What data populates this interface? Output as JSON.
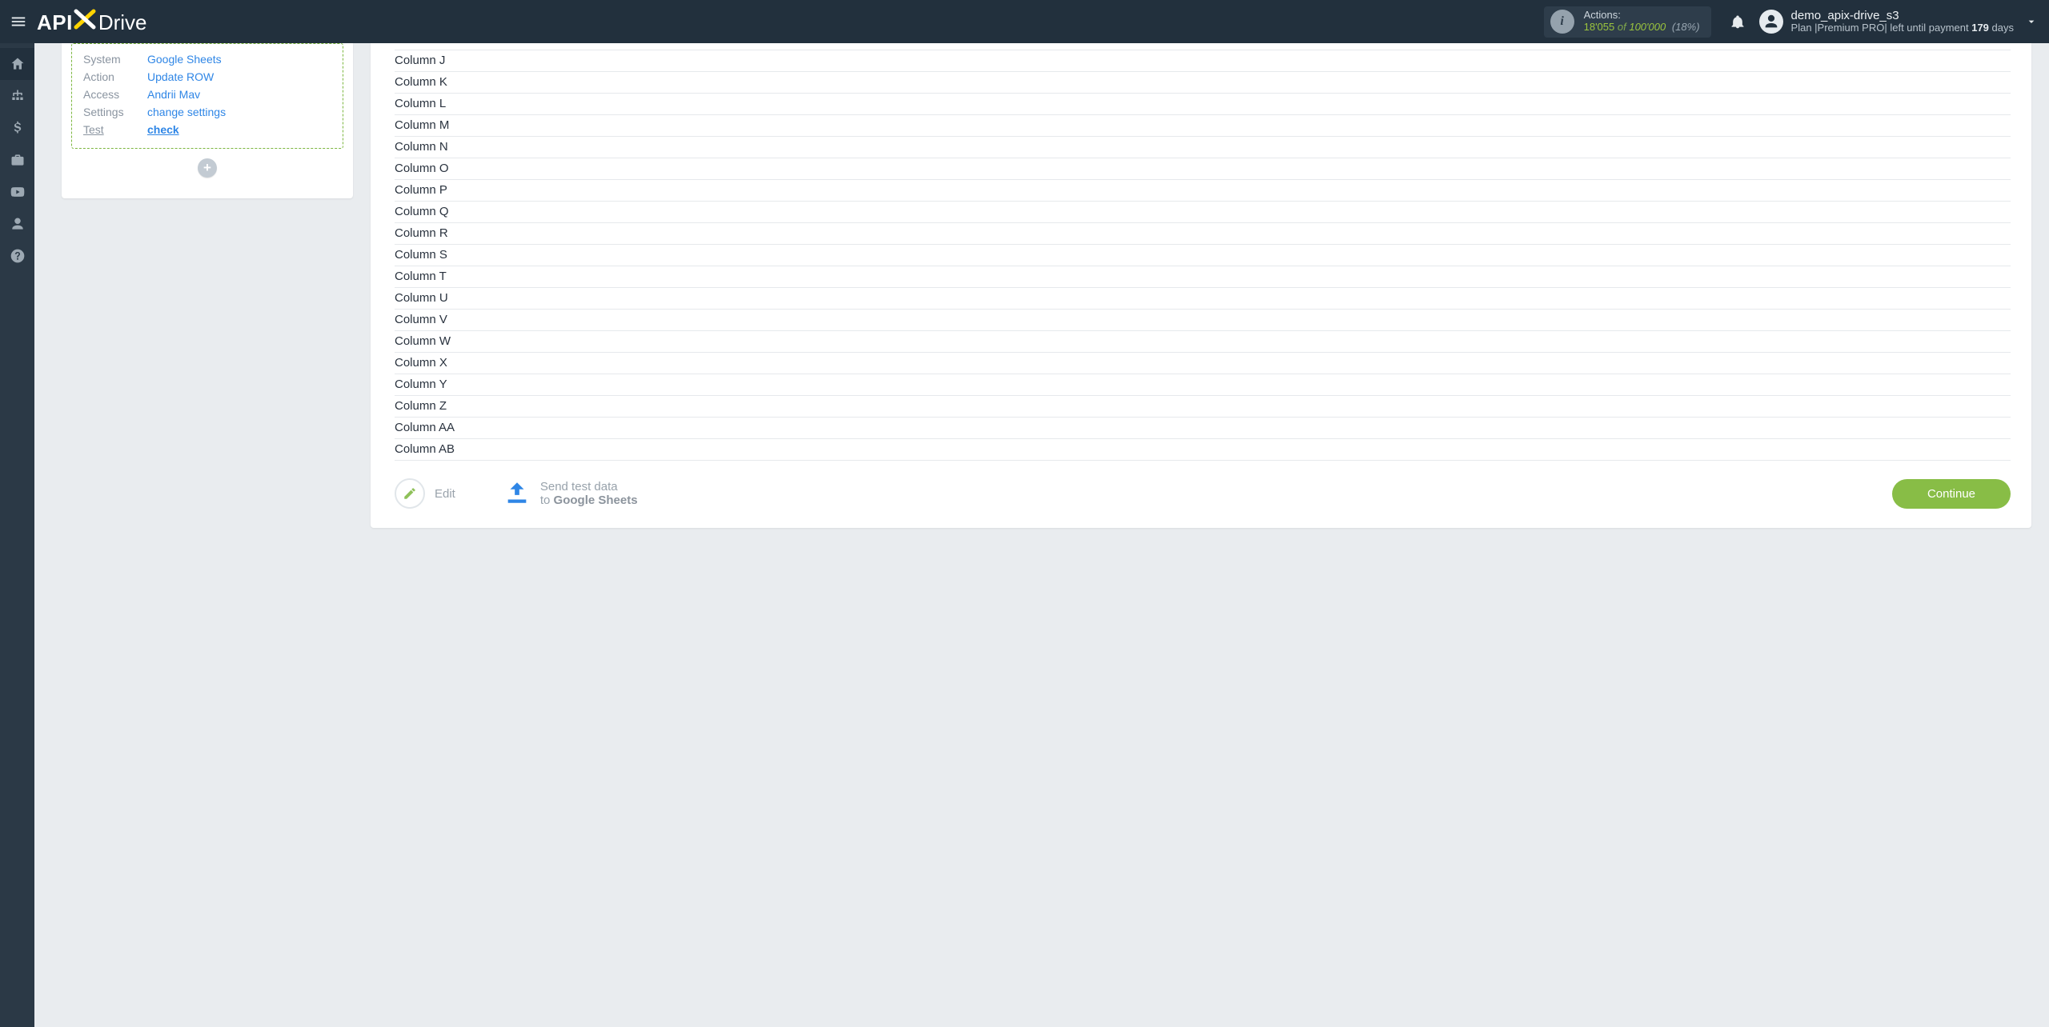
{
  "header": {
    "logo": {
      "api": "API",
      "drive": "Drive"
    },
    "actions": {
      "label": "Actions:",
      "used": "18'055",
      "of": "of",
      "total": "100'000",
      "percent": "(18%)"
    },
    "user": {
      "name": "demo_apix-drive_s3",
      "plan_prefix": "Plan |",
      "plan_name": "Premium PRO",
      "plan_mid": "| left until payment ",
      "plan_days_num": "179",
      "plan_days_word": " days"
    }
  },
  "left_card": {
    "rows": [
      {
        "k": "System",
        "v": "Google Sheets"
      },
      {
        "k": "Action",
        "v": "Update ROW"
      },
      {
        "k": "Access",
        "v": "Andrii Mav"
      },
      {
        "k": "Settings",
        "v": "change settings"
      },
      {
        "k": "Test",
        "v": "check",
        "k_underline": true,
        "v_bold": true,
        "v_underline": true
      }
    ],
    "add_label": "+"
  },
  "columns": [
    "J",
    "K",
    "L",
    "M",
    "N",
    "O",
    "P",
    "Q",
    "R",
    "S",
    "T",
    "U",
    "V",
    "W",
    "X",
    "Y",
    "Z",
    "AA",
    "AB"
  ],
  "column_prefix": "Column ",
  "footer": {
    "edit": "Edit",
    "send_l1": "Send test data",
    "send_l2_pre": "to ",
    "send_l2_bold": "Google Sheets",
    "continue": "Continue"
  }
}
